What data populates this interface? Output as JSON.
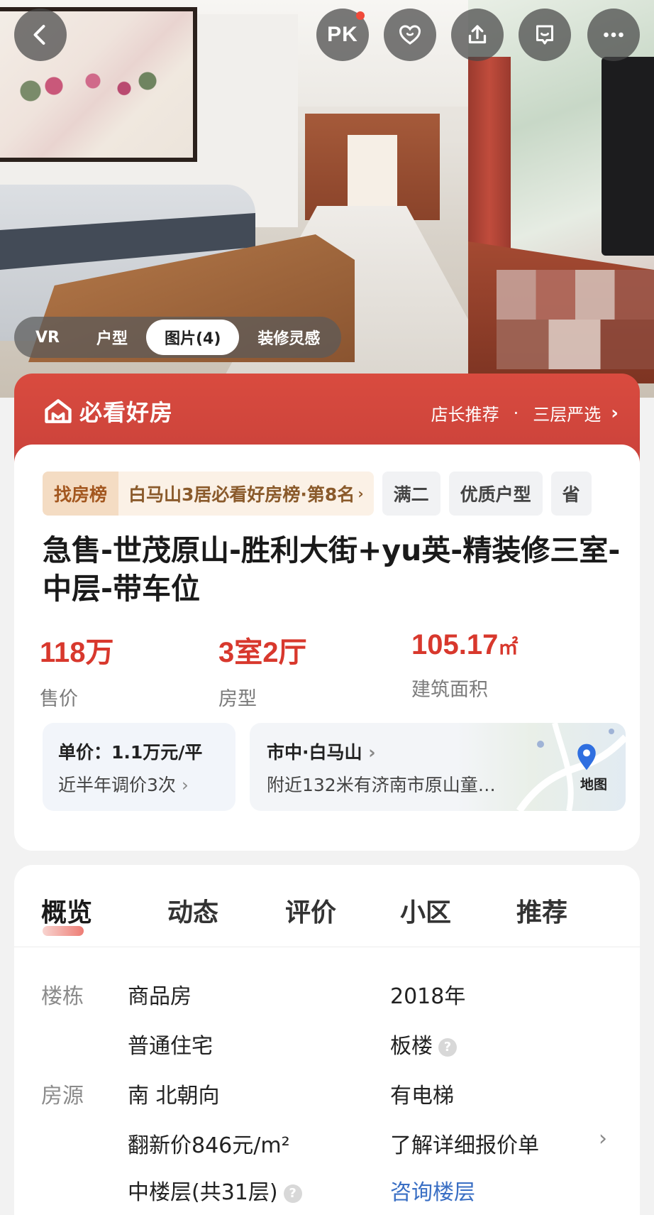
{
  "topbar": {
    "pk_label": "PK"
  },
  "media_tabs": [
    {
      "label": "VR"
    },
    {
      "label": "户型"
    },
    {
      "label": "图片(4)"
    },
    {
      "label": "装修灵感"
    }
  ],
  "banner": {
    "logo_text": "必看好房",
    "right_text_1": "店长推荐",
    "dot": "·",
    "right_text_2": "三层严选",
    "chevron": "›"
  },
  "tags": {
    "rank_label": "找房榜",
    "rank_text": "白马山3居必看好房榜·第8名",
    "rank_chevron": "›",
    "tag_1": "满二",
    "tag_2": "优质户型",
    "tag_3": "省"
  },
  "listing": {
    "title": "急售-世茂原山-胜利大街+yu英-精装修三室-中层-带车位"
  },
  "kpis": {
    "price_value": "118万",
    "price_label": "售价",
    "layout_value": "3室2厅",
    "layout_label": "房型",
    "area_value": "105.17",
    "area_unit": "㎡",
    "area_label": "建筑面积"
  },
  "price_box": {
    "unit_price": "单价：1.1万元/平",
    "adjust": "近半年调价3次",
    "chevron": "›"
  },
  "map_box": {
    "district": "市中·白马山",
    "chevron": "›",
    "nearby": "附近132米有济南市原山童…",
    "map_label": "地图"
  },
  "overview_nav": [
    {
      "label": "概览"
    },
    {
      "label": "动态"
    },
    {
      "label": "评价"
    },
    {
      "label": "小区"
    },
    {
      "label": "推荐"
    }
  ],
  "overview": {
    "building_label": "楼栋",
    "building_type": "商品房",
    "year": "2018年",
    "usage": "普通住宅",
    "structure": "板楼",
    "source_label": "房源",
    "orientation": "南 北朝向",
    "elevator": "有电梯",
    "renovation_price": "翻新价846元/m²",
    "quote_link": "了解详细报价单",
    "floor": "中楼层(共31层)",
    "consult_floor": "咨询楼层",
    "help_glyph": "?",
    "chevron": "›"
  }
}
